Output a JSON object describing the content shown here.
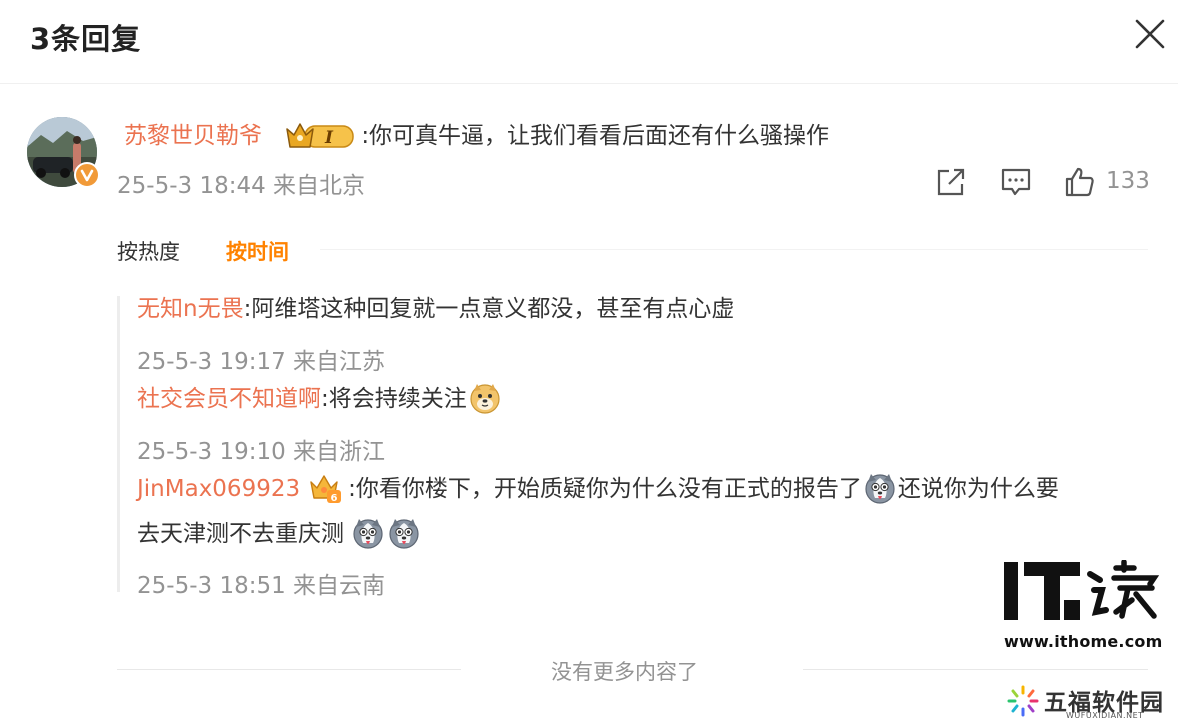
{
  "header": {
    "title": "3条回复"
  },
  "main_comment": {
    "username": "苏黎世贝勒爷",
    "badge_text": "I",
    "text": ":你可真牛逼，让我们看看后面还有什么骚操作",
    "meta": "25-5-3 18:44 来自北京",
    "like_count": "133"
  },
  "sort": {
    "hot_label": "按热度",
    "time_label": "按时间",
    "active": "time"
  },
  "replies": [
    {
      "username": "无知n无畏",
      "text": ":阿维塔这种回复就一点意义都没，甚至有点心虚",
      "meta": "25-5-3 19:17 来自江苏"
    },
    {
      "username": "社交会员不知道啊",
      "text": ":将会持续关注",
      "emoji": "doge-emoji",
      "meta": "25-5-3 19:10 来自浙江"
    },
    {
      "username": "JinMax069923",
      "badge_text": "6",
      "text_a": ":你看你楼下，开始质疑你为什么没有正式的报告了",
      "text_b": "还说你为什么要",
      "text_c": "去天津测不去重庆测",
      "emoji": "husky-emoji",
      "meta": "25-5-3 18:51 来自云南"
    }
  ],
  "footer": {
    "end_text": "没有更多内容了"
  },
  "watermarks": {
    "ithome_logo": "IT之家",
    "ithome_url": "www.ithome.com",
    "wufu_name": "五福软件园",
    "wufu_sub": "WUFUXIDIAN.NET"
  },
  "colors": {
    "username": "#eb7350",
    "active_sort": "#ff8200",
    "meta": "#939393"
  }
}
